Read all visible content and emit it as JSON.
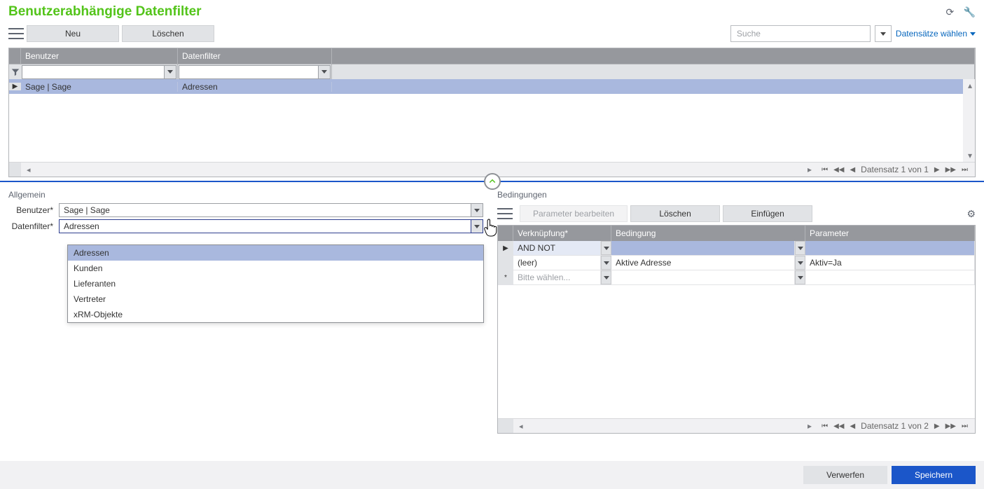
{
  "title": "Benutzerabhängige Datenfilter",
  "toolbar": {
    "new": "Neu",
    "delete": "Löschen",
    "search_placeholder": "Suche",
    "choose_records": "Datensätze wählen"
  },
  "grid": {
    "col_user": "Benutzer",
    "col_filter": "Datenfilter",
    "row_user": "Sage  |  Sage",
    "row_filter": "Adressen",
    "pager": "Datensatz 1 von 1"
  },
  "sections": {
    "general": "Allgemein",
    "conditions": "Bedingungen"
  },
  "form": {
    "user_label": "Benutzer*",
    "user_value": "Sage  |  Sage",
    "filter_label": "Datenfilter*",
    "filter_value": "Adressen",
    "options": [
      "Adressen",
      "Kunden",
      "Lieferanten",
      "Vertreter",
      "xRM-Objekte"
    ]
  },
  "cond_toolbar": {
    "edit": "Parameter bearbeiten",
    "delete": "Löschen",
    "insert": "Einfügen"
  },
  "cond_grid": {
    "col_link": "Verknüpfung*",
    "col_cond": "Bedingung",
    "col_param": "Parameter",
    "rows": [
      {
        "marker": "▶",
        "link": "AND NOT",
        "cond": "",
        "param": ""
      },
      {
        "marker": "",
        "link": "(leer)",
        "cond": "Aktive Adresse",
        "param": "Aktiv=Ja"
      },
      {
        "marker": "*",
        "link": "Bitte wählen...",
        "cond": "",
        "param": "",
        "ghost": true
      }
    ],
    "pager": "Datensatz 1 von 2"
  },
  "footer": {
    "discard": "Verwerfen",
    "save": "Speichern"
  }
}
